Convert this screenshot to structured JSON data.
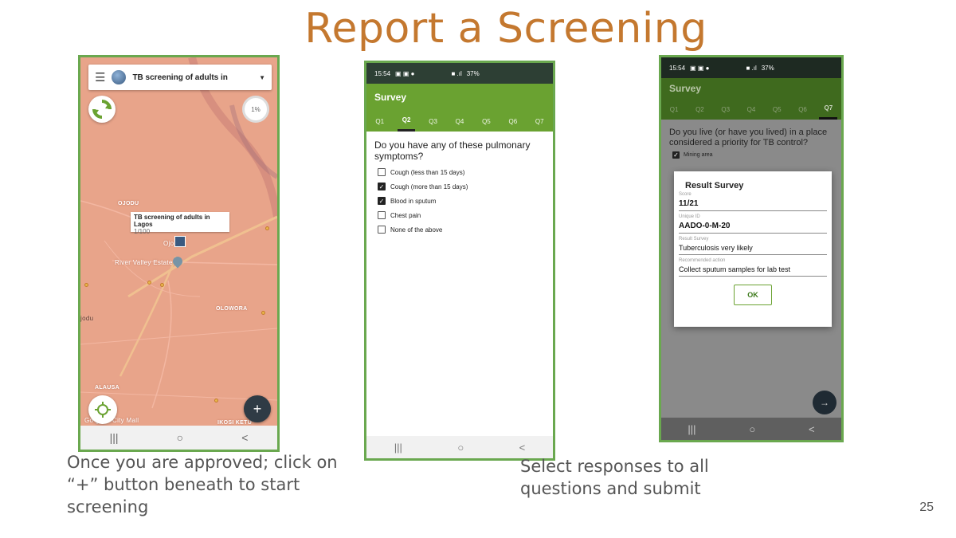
{
  "slide": {
    "title": "Report a Screening",
    "caption_left": "Once you are approved; click on “+” button beneath to start screening",
    "caption_right": "Select responses to all questions and submit",
    "page_number": "25"
  },
  "phone_map": {
    "topbar_title": "TB screening of adults in",
    "progress": "1%",
    "labels": {
      "ojodu": "OJODU",
      "olowora": "OLOWORA",
      "alausa": "ALAUSA",
      "ikosi_ketu": "IKOSI KETU",
      "river_valley": "River Valley Estate",
      "city_mall": "City Mall",
      "jodu": "jodu",
      "ojo": "Ojo",
      "logo_google": "Go  gle"
    },
    "tooltip_title": "TB screening of adults in Lagos",
    "tooltip_count": "1/100",
    "fab_symbol": "+",
    "nav": [
      "|||",
      "○",
      "<"
    ]
  },
  "phone_survey": {
    "time": "15:54",
    "battery": "37%",
    "header": "Survey",
    "tabs": [
      "Q1",
      "Q2",
      "Q3",
      "Q4",
      "Q5",
      "Q6",
      "Q7"
    ],
    "active_tab": "Q2",
    "question": "Do you have any of these pulmonary symptoms?",
    "options": [
      {
        "label": "Cough (less than 15 days)",
        "checked": false
      },
      {
        "label": "Cough (more than 15 days)",
        "checked": true
      },
      {
        "label": "Blood in sputum",
        "checked": true
      },
      {
        "label": "Chest pain",
        "checked": false
      },
      {
        "label": "None of the above",
        "checked": false
      }
    ],
    "nav": [
      "|||",
      "○",
      "<"
    ]
  },
  "phone_result": {
    "time": "15:54",
    "battery": "37%",
    "header": "Survey",
    "tabs": [
      "Q1",
      "Q2",
      "Q3",
      "Q4",
      "Q5",
      "Q6",
      "Q7"
    ],
    "active_tab": "Q7",
    "question": "Do you live (or have you lived) in a place considered a priority for TB control?",
    "option": "Mining area",
    "dialog": {
      "title": "Result Survey",
      "score_label": "Score",
      "score": "11/21",
      "id_label": "Unique ID",
      "id": "AADO-0-M-20",
      "result_label": "Result Survey",
      "result": "Tuberculosis very likely",
      "action_label": "Recommended action",
      "action": "Collect sputum samples for lab test",
      "ok": "OK"
    },
    "fab_symbol": "→",
    "nav": [
      "|||",
      "○",
      "<"
    ]
  }
}
